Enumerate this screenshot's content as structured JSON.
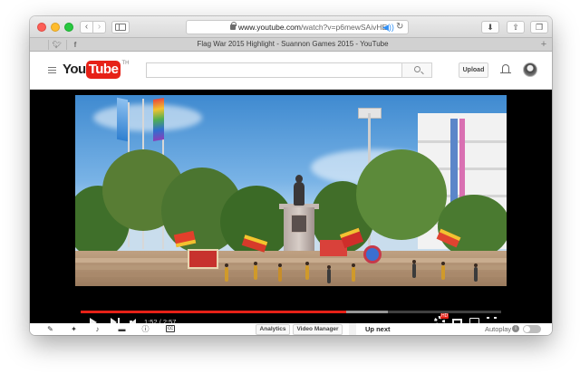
{
  "browser": {
    "url_host": "www.youtube.com",
    "url_path": "/watch?v=p6mewSAivHE",
    "tab_title": "Flag War 2015 Highlight - Suannon Games 2015 - YouTube",
    "favorites": [
      "apple-icon",
      "twitter-icon",
      "facebook-icon"
    ],
    "new_tab_label": "+"
  },
  "header": {
    "logo_you": "You",
    "logo_tube": "Tube",
    "logo_region": "TH",
    "search_value": "",
    "upload_label": "Upload"
  },
  "player": {
    "current_time": "1:52",
    "duration": "2:57",
    "time_display": "1:52 / 2:57",
    "played_fraction": 0.632,
    "buffered_fraction": 0.73,
    "hd_badge": "HD"
  },
  "actions": {
    "analytics_label": "Analytics",
    "video_manager_label": "Video Manager"
  },
  "sidebar": {
    "up_next_label": "Up next",
    "autoplay_label": "Autoplay",
    "autoplay_on": false
  },
  "colors": {
    "brand_red": "#e62117",
    "accent_blue": "#2f8ff6"
  }
}
